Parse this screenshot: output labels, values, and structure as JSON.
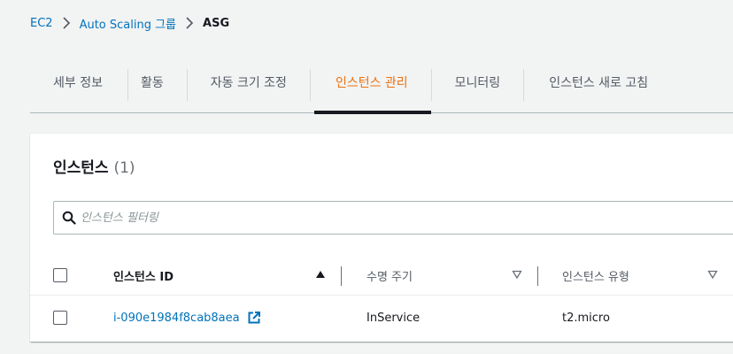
{
  "breadcrumb": {
    "items": [
      "EC2",
      "Auto Scaling 그룹",
      "ASG"
    ]
  },
  "tabs": [
    {
      "label": "세부 정보",
      "active": false
    },
    {
      "label": "활동",
      "active": false
    },
    {
      "label": "자동 크기 조정",
      "active": false
    },
    {
      "label": "인스턴스 관리",
      "active": true
    },
    {
      "label": "모니터링",
      "active": false
    },
    {
      "label": "인스턴스 새로 고침",
      "active": false
    }
  ],
  "panel": {
    "title": "인스턴스",
    "count": "(1)",
    "filter_placeholder": "인스턴스 필터링"
  },
  "table": {
    "columns": [
      {
        "label": "인스턴스 ID",
        "sort": "ascending"
      },
      {
        "label": "수명 주기",
        "sort": "none"
      },
      {
        "label": "인스턴스 유형",
        "sort": "none"
      }
    ],
    "rows": [
      {
        "instance_id": "i-090e1984f8cab8aea",
        "lifecycle": "InService",
        "instance_type": "t2.micro"
      }
    ]
  },
  "colors": {
    "accent": "#ec7211",
    "link": "#0073bb",
    "text": "#16191f"
  }
}
